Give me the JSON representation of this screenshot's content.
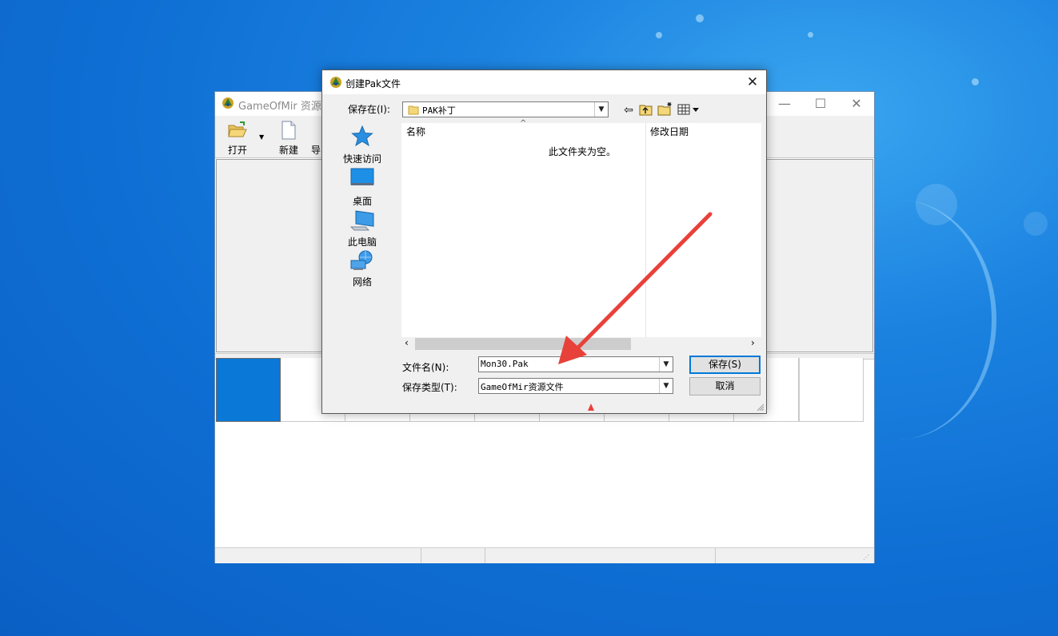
{
  "main_window": {
    "title": "GameOfMir 资源编",
    "toolbar": {
      "open_label": "打开",
      "new_label": "新建",
      "third_label": "导"
    },
    "window_buttons": {
      "minimize": "—",
      "maximize": "☐",
      "close": "✕"
    }
  },
  "dialog": {
    "title": "创建Pak文件",
    "close_glyph": "✕",
    "save_in_label": "保存在(I):",
    "save_in_value": "PAK补丁",
    "places": [
      {
        "label": "快速访问",
        "icon": "star-icon"
      },
      {
        "label": "桌面",
        "icon": "desktop-icon"
      },
      {
        "label": "此电脑",
        "icon": "computer-icon"
      },
      {
        "label": "网络",
        "icon": "network-icon"
      }
    ],
    "columns": {
      "name": "名称",
      "modified": "修改日期"
    },
    "empty_text": "此文件夹为空。",
    "filename_label": "文件名(N):",
    "filename_value": "Mon30.Pak",
    "filetype_label": "保存类型(T):",
    "filetype_value": "GameOfMir资源文件",
    "save_button": "保存(S)",
    "cancel_button": "取消",
    "nav_icons": [
      "back-arrow-icon",
      "up-folder-icon",
      "new-folder-icon",
      "view-menu-icon"
    ]
  },
  "colors": {
    "desktop": "#1b82e0",
    "selected_tile": "#0a78d7",
    "annotation_arrow": "#e8413a"
  }
}
